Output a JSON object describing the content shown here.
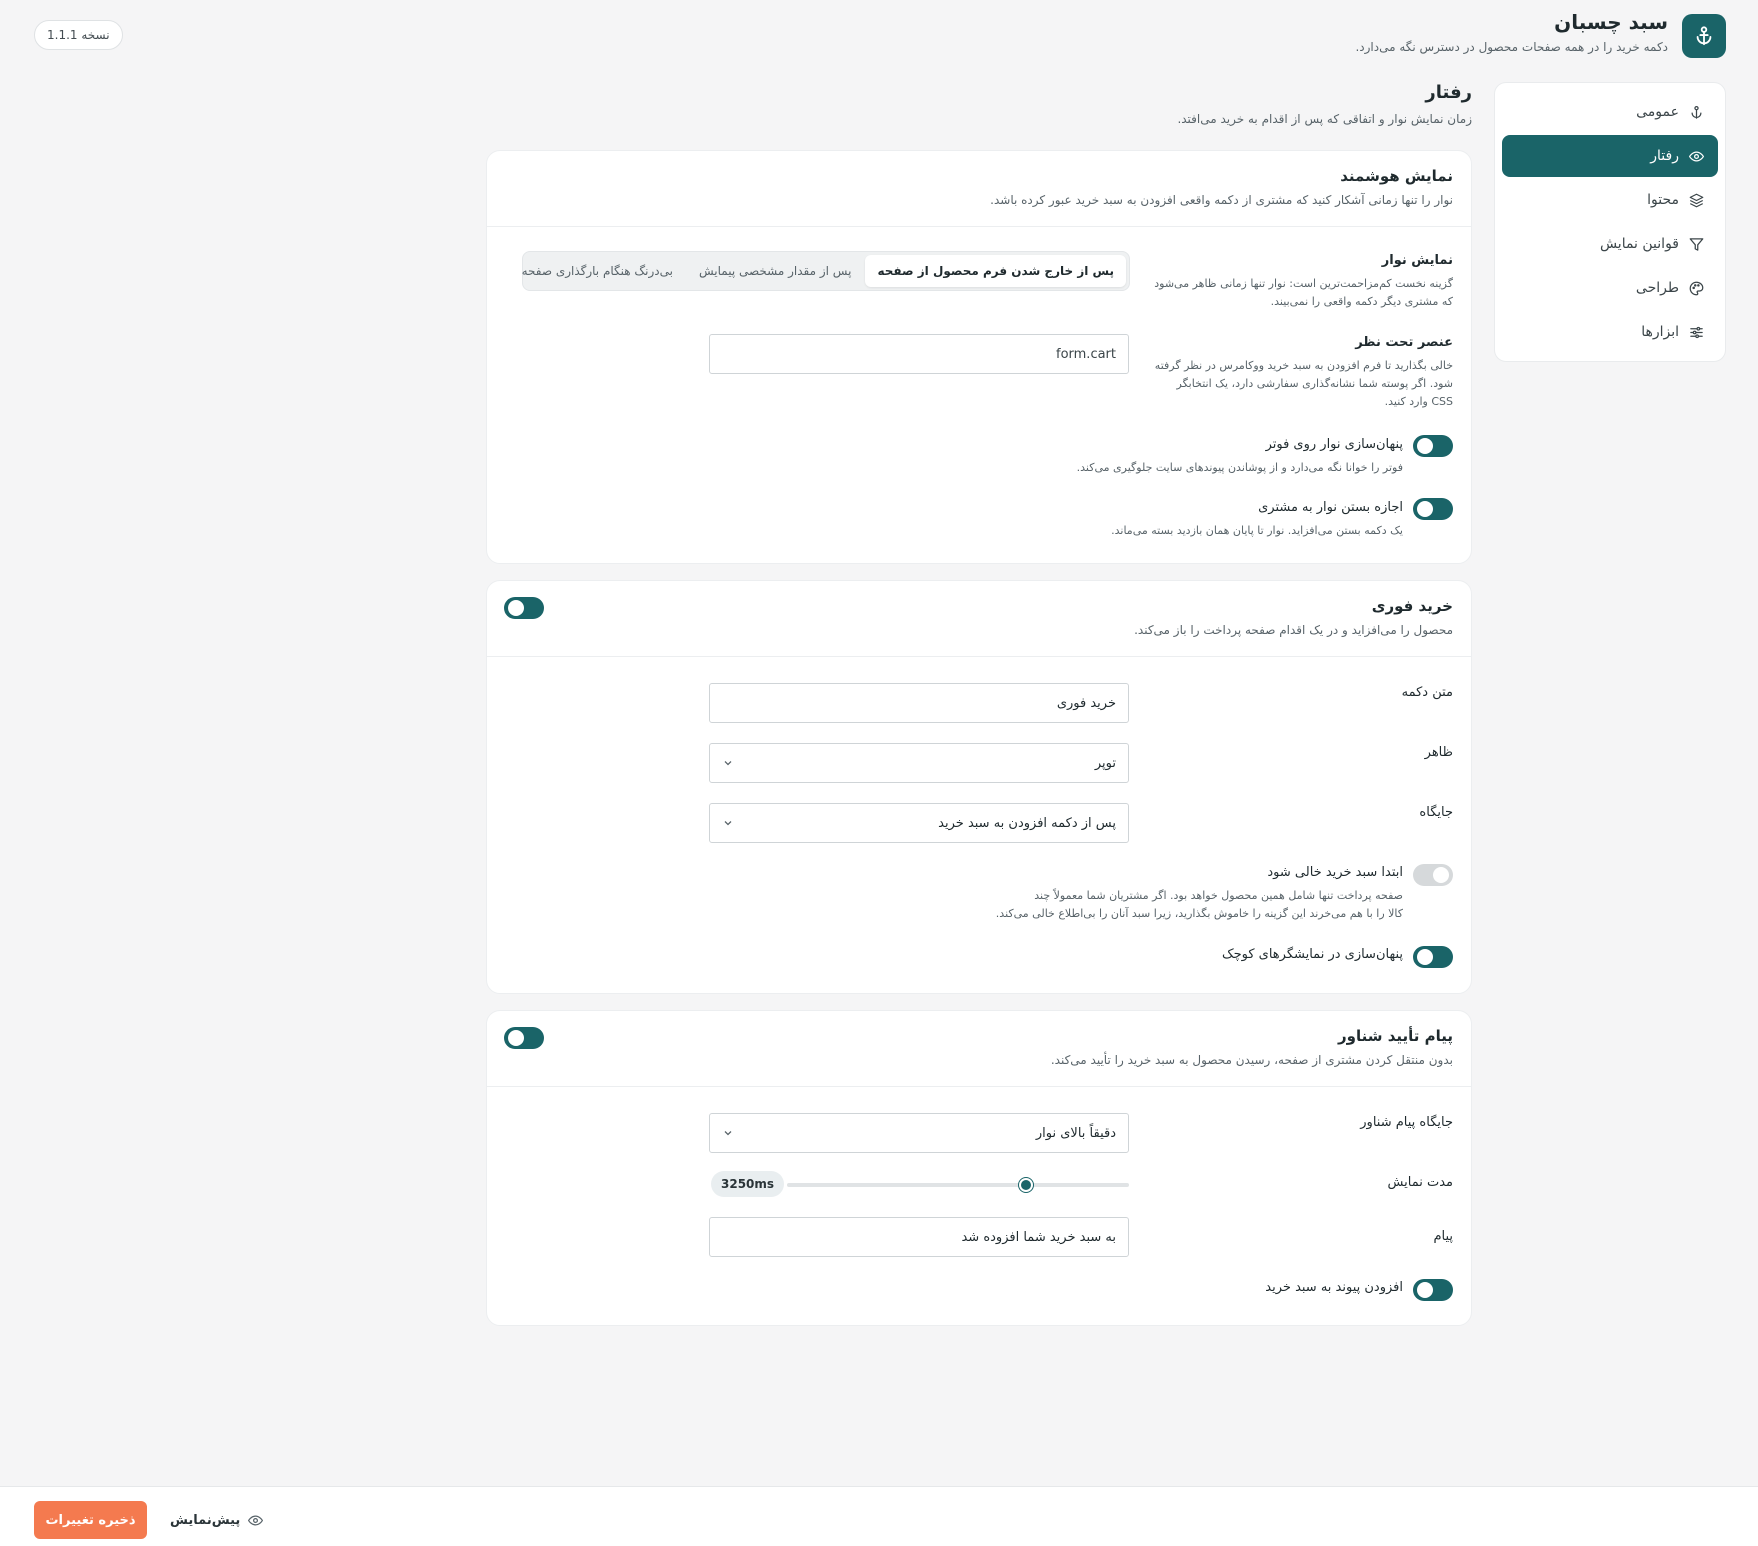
{
  "header": {
    "title": "سبد چسبان",
    "subtitle": "دکمه خرید را در همه صفحات محصول در دسترس نگه می‌دارد.",
    "version_badge": "نسخه 1.1.1",
    "icon": "anchor-icon"
  },
  "sidebar": {
    "items": [
      {
        "label": "عمومی",
        "icon": "anchor-icon",
        "active": false
      },
      {
        "label": "رفتار",
        "icon": "eye-icon",
        "active": true
      },
      {
        "label": "محتوا",
        "icon": "layers-icon",
        "active": false
      },
      {
        "label": "قوانین نمایش",
        "icon": "filter-icon",
        "active": false
      },
      {
        "label": "طراحی",
        "icon": "palette-icon",
        "active": false
      },
      {
        "label": "ابزارها",
        "icon": "sliders-icon",
        "active": false
      }
    ]
  },
  "section": {
    "title": "رفتار",
    "description": "زمان نمایش نوار و اتفاقی که پس از اقدام به خرید می‌افتد."
  },
  "smart_display": {
    "title": "نمایش هوشمند",
    "description": "نوار را تنها زمانی آشکار کنید که مشتری از دکمه واقعی افزودن به سبد خرید عبور کرده باشد.",
    "bar_display": {
      "label": "نمایش نوار",
      "help": "گزینه نخست کم‌مزاحمت‌ترین است: نوار تنها زمانی ظاهر می‌شود که مشتری دیگر دکمه واقعی را نمی‌بیند.",
      "options": [
        "پس از خارج شدن فرم محصول از صفحه",
        "پس از مقدار مشخصی پیمایش",
        "بی‌درنگ هنگام بارگذاری صفحه"
      ],
      "selected": "پس از خارج شدن فرم محصول از صفحه"
    },
    "target_element": {
      "label": "عنصر تحت نظر",
      "help": "خالی بگذارید تا فرم افزودن به سبد خرید ووکامرس در نظر گرفته شود. اگر پوسته شما نشانه‌گذاری سفارشی دارد، یک انتخابگر CSS وارد کنید.",
      "value": "form.cart"
    },
    "hide_footer": {
      "label": "پنهان‌سازی نوار روی فوتر",
      "help": "فوتر را خوانا نگه می‌دارد و از پوشاندن پیوندهای سایت جلوگیری می‌کند.",
      "on": true
    },
    "allow_close": {
      "label": "اجازه بستن نوار به مشتری",
      "help": "یک دکمه بستن می‌افزاید. نوار تا پایان همان بازدید بسته می‌ماند.",
      "on": true
    }
  },
  "buy_now": {
    "title": "خرید فوری",
    "description": "محصول را می‌افزاید و در یک اقدام صفحه پرداخت را باز می‌کند.",
    "enabled": true,
    "button_text": {
      "label": "متن دکمه",
      "value": "خرید فوری"
    },
    "appearance": {
      "label": "ظاهر",
      "value": "توپر"
    },
    "position": {
      "label": "جایگاه",
      "value": "پس از دکمه افزودن به سبد خرید"
    },
    "empty_cart": {
      "label": "ابتدا سبد خرید خالی شود",
      "help_line1": "صفحه پرداخت تنها شامل همین محصول خواهد بود. اگر مشتریان شما معمولاً چند",
      "help_line2": "کالا را با هم می‌خرند این گزینه را خاموش بگذارید، زیرا سبد آنان را بی‌اطلاع خالی می‌کند.",
      "on": false
    },
    "hide_small": {
      "label": "پنهان‌سازی در نمایشگرهای کوچک",
      "on": true
    }
  },
  "floating_confirm": {
    "title": "پیام تأیید شناور",
    "description": "بدون منتقل کردن مشتری از صفحه، رسیدن محصول به سبد خرید را تأیید می‌کند.",
    "enabled": true,
    "position": {
      "label": "جایگاه پیام شناور",
      "value": "دقیقاً بالای نوار"
    },
    "duration": {
      "label": "مدت نمایش",
      "value_text": "3250ms",
      "fraction": 0.7
    },
    "message": {
      "label": "پیام",
      "value": "به سبد خرید شما افزوده شد"
    },
    "add_link": {
      "label": "افزودن پیوند به سبد خرید",
      "on": true
    }
  },
  "footer": {
    "save_label": "ذخیره تغییرات",
    "preview_label": "پیش‌نمایش"
  },
  "colors": {
    "primary": "#1a6468",
    "accent": "#f47a4f",
    "background": "#f5f5f6"
  }
}
